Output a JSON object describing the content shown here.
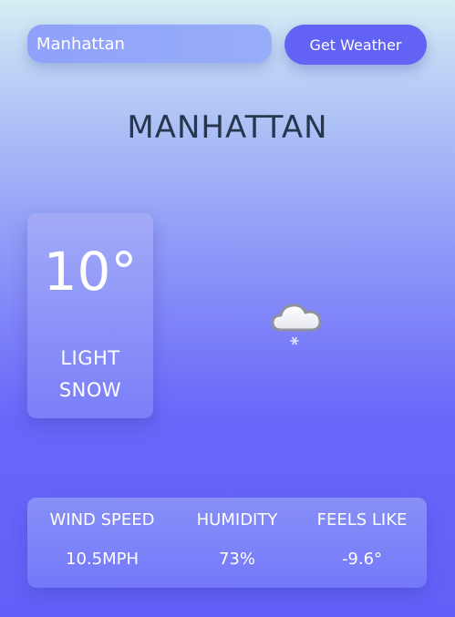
{
  "search": {
    "value": "Manhattan",
    "button_label": "Get Weather"
  },
  "city": {
    "name": "MANHATTAN"
  },
  "current": {
    "temperature": "10°",
    "condition_line1": "LIGHT",
    "condition_line2": "SNOW",
    "icon": "light-snow-cloud-icon"
  },
  "stats": {
    "wind_speed_label": "WIND SPEED",
    "wind_speed_value": "10.5MPH",
    "humidity_label": "HUMIDITY",
    "humidity_value": "73%",
    "feels_like_label": "FEELS LIKE",
    "feels_like_value": "-9.6°"
  },
  "colors": {
    "button": "#6262f5",
    "title": "#26364d",
    "background_top": "#d5eef3",
    "background_bottom": "#6161f9"
  }
}
